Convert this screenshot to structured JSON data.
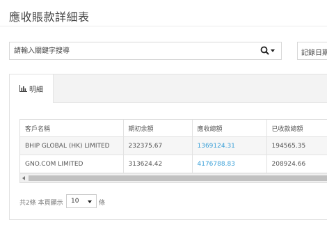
{
  "page": {
    "title": "應收賬款詳細表"
  },
  "search": {
    "placeholder": "請輸入關鍵字搜導",
    "button_icon": "search-icon",
    "dropdown_icon": "caret-down-icon"
  },
  "filter": {
    "record_date_label": "記錄日期"
  },
  "tabs": [
    {
      "label": "明細",
      "icon": "bar-chart-icon",
      "active": true
    }
  ],
  "table": {
    "headers": [
      "客戶名稱",
      "期初余額",
      "應收總額",
      "已收款總額"
    ],
    "rows": [
      [
        "BHIP GLOBAL (HK) LIMITED",
        "232375.67",
        "1369124.31",
        "194565.35"
      ],
      [
        "GNO.COM LIMITED",
        "313624.42",
        "4176788.83",
        "208924.66"
      ]
    ]
  },
  "pager": {
    "summary": "共2條 本頁顯示",
    "page_size": "10",
    "suffix": "條"
  },
  "colors": {
    "link": "#3aa0d8",
    "tab_bar_bg": "#f3f3f3"
  }
}
